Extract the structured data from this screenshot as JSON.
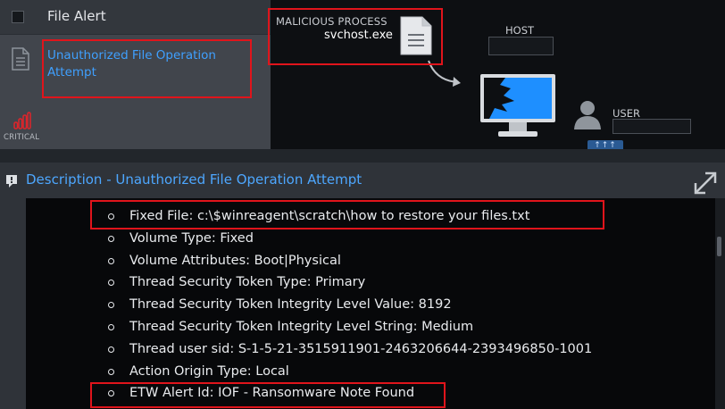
{
  "alert": {
    "header_title": "File Alert",
    "name": "Unauthorized File Operation Attempt",
    "severity_label": "CRITICAL"
  },
  "graph": {
    "process_label": "MALICIOUS PROCESS",
    "process_name": "svchost.exe",
    "host_label": "HOST",
    "user_label": "USER",
    "user_badge": "↑↑↑"
  },
  "description": {
    "title": "Description - Unauthorized File Operation Attempt",
    "items": [
      "Fixed File: c:\\$winreagent\\scratch\\how to restore your files.txt",
      "Volume Type: Fixed",
      "Volume Attributes: Boot|Physical",
      "Thread Security Token Type: Primary",
      "Thread Security Token Integrity Level Value: 8192",
      "Thread Security Token Integrity Level String: Medium",
      "Thread user sid: S-1-5-21-3515911901-2463206644-2393496850-1001",
      "Action Origin Type: Local",
      "ETW Alert Id: IOF - Ransomware Note Found"
    ]
  },
  "colors": {
    "link": "#3fa0ff",
    "highlight": "#e0141b",
    "severity": "#e0242a",
    "monitor_screen": "#1e8fff"
  }
}
